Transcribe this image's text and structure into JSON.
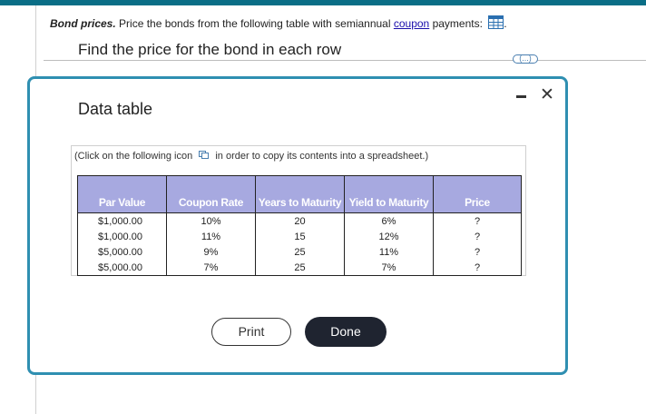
{
  "problem": {
    "title": "Bond prices.",
    "text_before_link": " Price the bonds from the following table with semiannual ",
    "link": "coupon",
    "text_after_link": " payments: ",
    "trailing": "."
  },
  "instruction": "Find the price for the bond in each row",
  "more_button": "(...)",
  "modal": {
    "title": "Data table",
    "close": "✕",
    "copy_note_before": "(Click on the following icon ",
    "copy_note_after": " in order to copy its contents into a spreadsheet.)",
    "table": {
      "headers": [
        "Par Value",
        "Coupon Rate",
        "Years to Maturity",
        "Yield to Maturity",
        "Price"
      ],
      "rows": [
        [
          "$1,000.00",
          "10%",
          "20",
          "6%",
          "?"
        ],
        [
          "$1,000.00",
          "11%",
          "15",
          "12%",
          "?"
        ],
        [
          "$5,000.00",
          "9%",
          "25",
          "11%",
          "?"
        ],
        [
          "$5,000.00",
          "7%",
          "25",
          "7%",
          "?"
        ]
      ]
    },
    "print_label": "Print",
    "done_label": "Done"
  },
  "colors": {
    "topbar": "#0a6e86",
    "modal_border": "#2f8fb1",
    "table_header_bg": "#a7a9e0",
    "done_button_bg": "#1f2430",
    "link": "#1a0dab"
  },
  "icons": [
    "table-icon",
    "copy-icon",
    "minimize-icon",
    "close-icon",
    "more-icon"
  ]
}
